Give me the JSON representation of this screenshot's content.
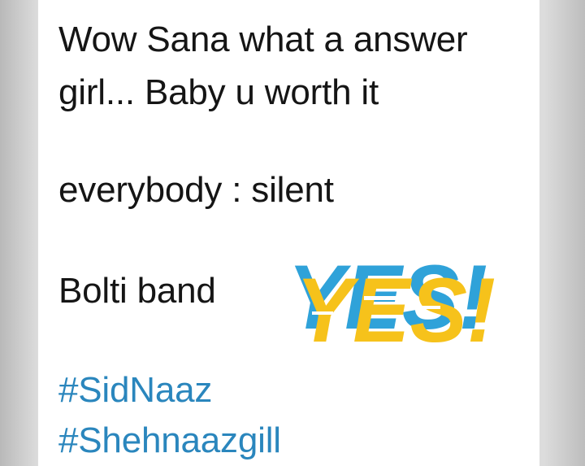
{
  "post": {
    "line1": "Wow Sana what a answer",
    "line2": "girl... Baby u worth it",
    "line3": "everybody : silent",
    "line4": "Bolti band",
    "hashtags": [
      "#SidNaaz",
      "#Shehnaazgill"
    ]
  },
  "sticker": {
    "text": "YES!",
    "icon": "yes-sticker",
    "fill_color": "#f6c21b",
    "shadow_color": "#2fa2d9"
  },
  "colors": {
    "text": "#151515",
    "hashtag": "#2a86bd",
    "card": "#ffffff",
    "backdrop": "#d6d6d6"
  }
}
